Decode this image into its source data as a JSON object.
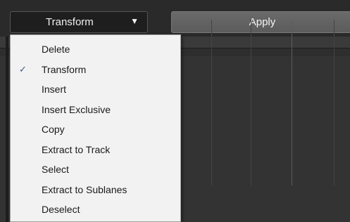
{
  "toolbar": {
    "dropdown_label": "Transform",
    "dropdown_arrow_icon": "triangle-down-icon",
    "apply_label": "Apply"
  },
  "menu": {
    "items": [
      {
        "label": "Delete",
        "checked": false
      },
      {
        "label": "Transform",
        "checked": true
      },
      {
        "label": "Insert",
        "checked": false
      },
      {
        "label": "Insert Exclusive",
        "checked": false
      },
      {
        "label": "Copy",
        "checked": false
      },
      {
        "label": "Extract to Track",
        "checked": false
      },
      {
        "label": "Select",
        "checked": false
      },
      {
        "label": "Extract to Sublanes",
        "checked": false
      },
      {
        "label": "Deselect",
        "checked": false
      }
    ],
    "check_icon": "checkmark-icon"
  },
  "colors": {
    "menu_background": "#f2f2f2",
    "toolbar_background": "#2a2a2a",
    "apply_button": "#646464",
    "dropdown_button": "#1e1e1e",
    "check_color": "#3a5c8c"
  }
}
